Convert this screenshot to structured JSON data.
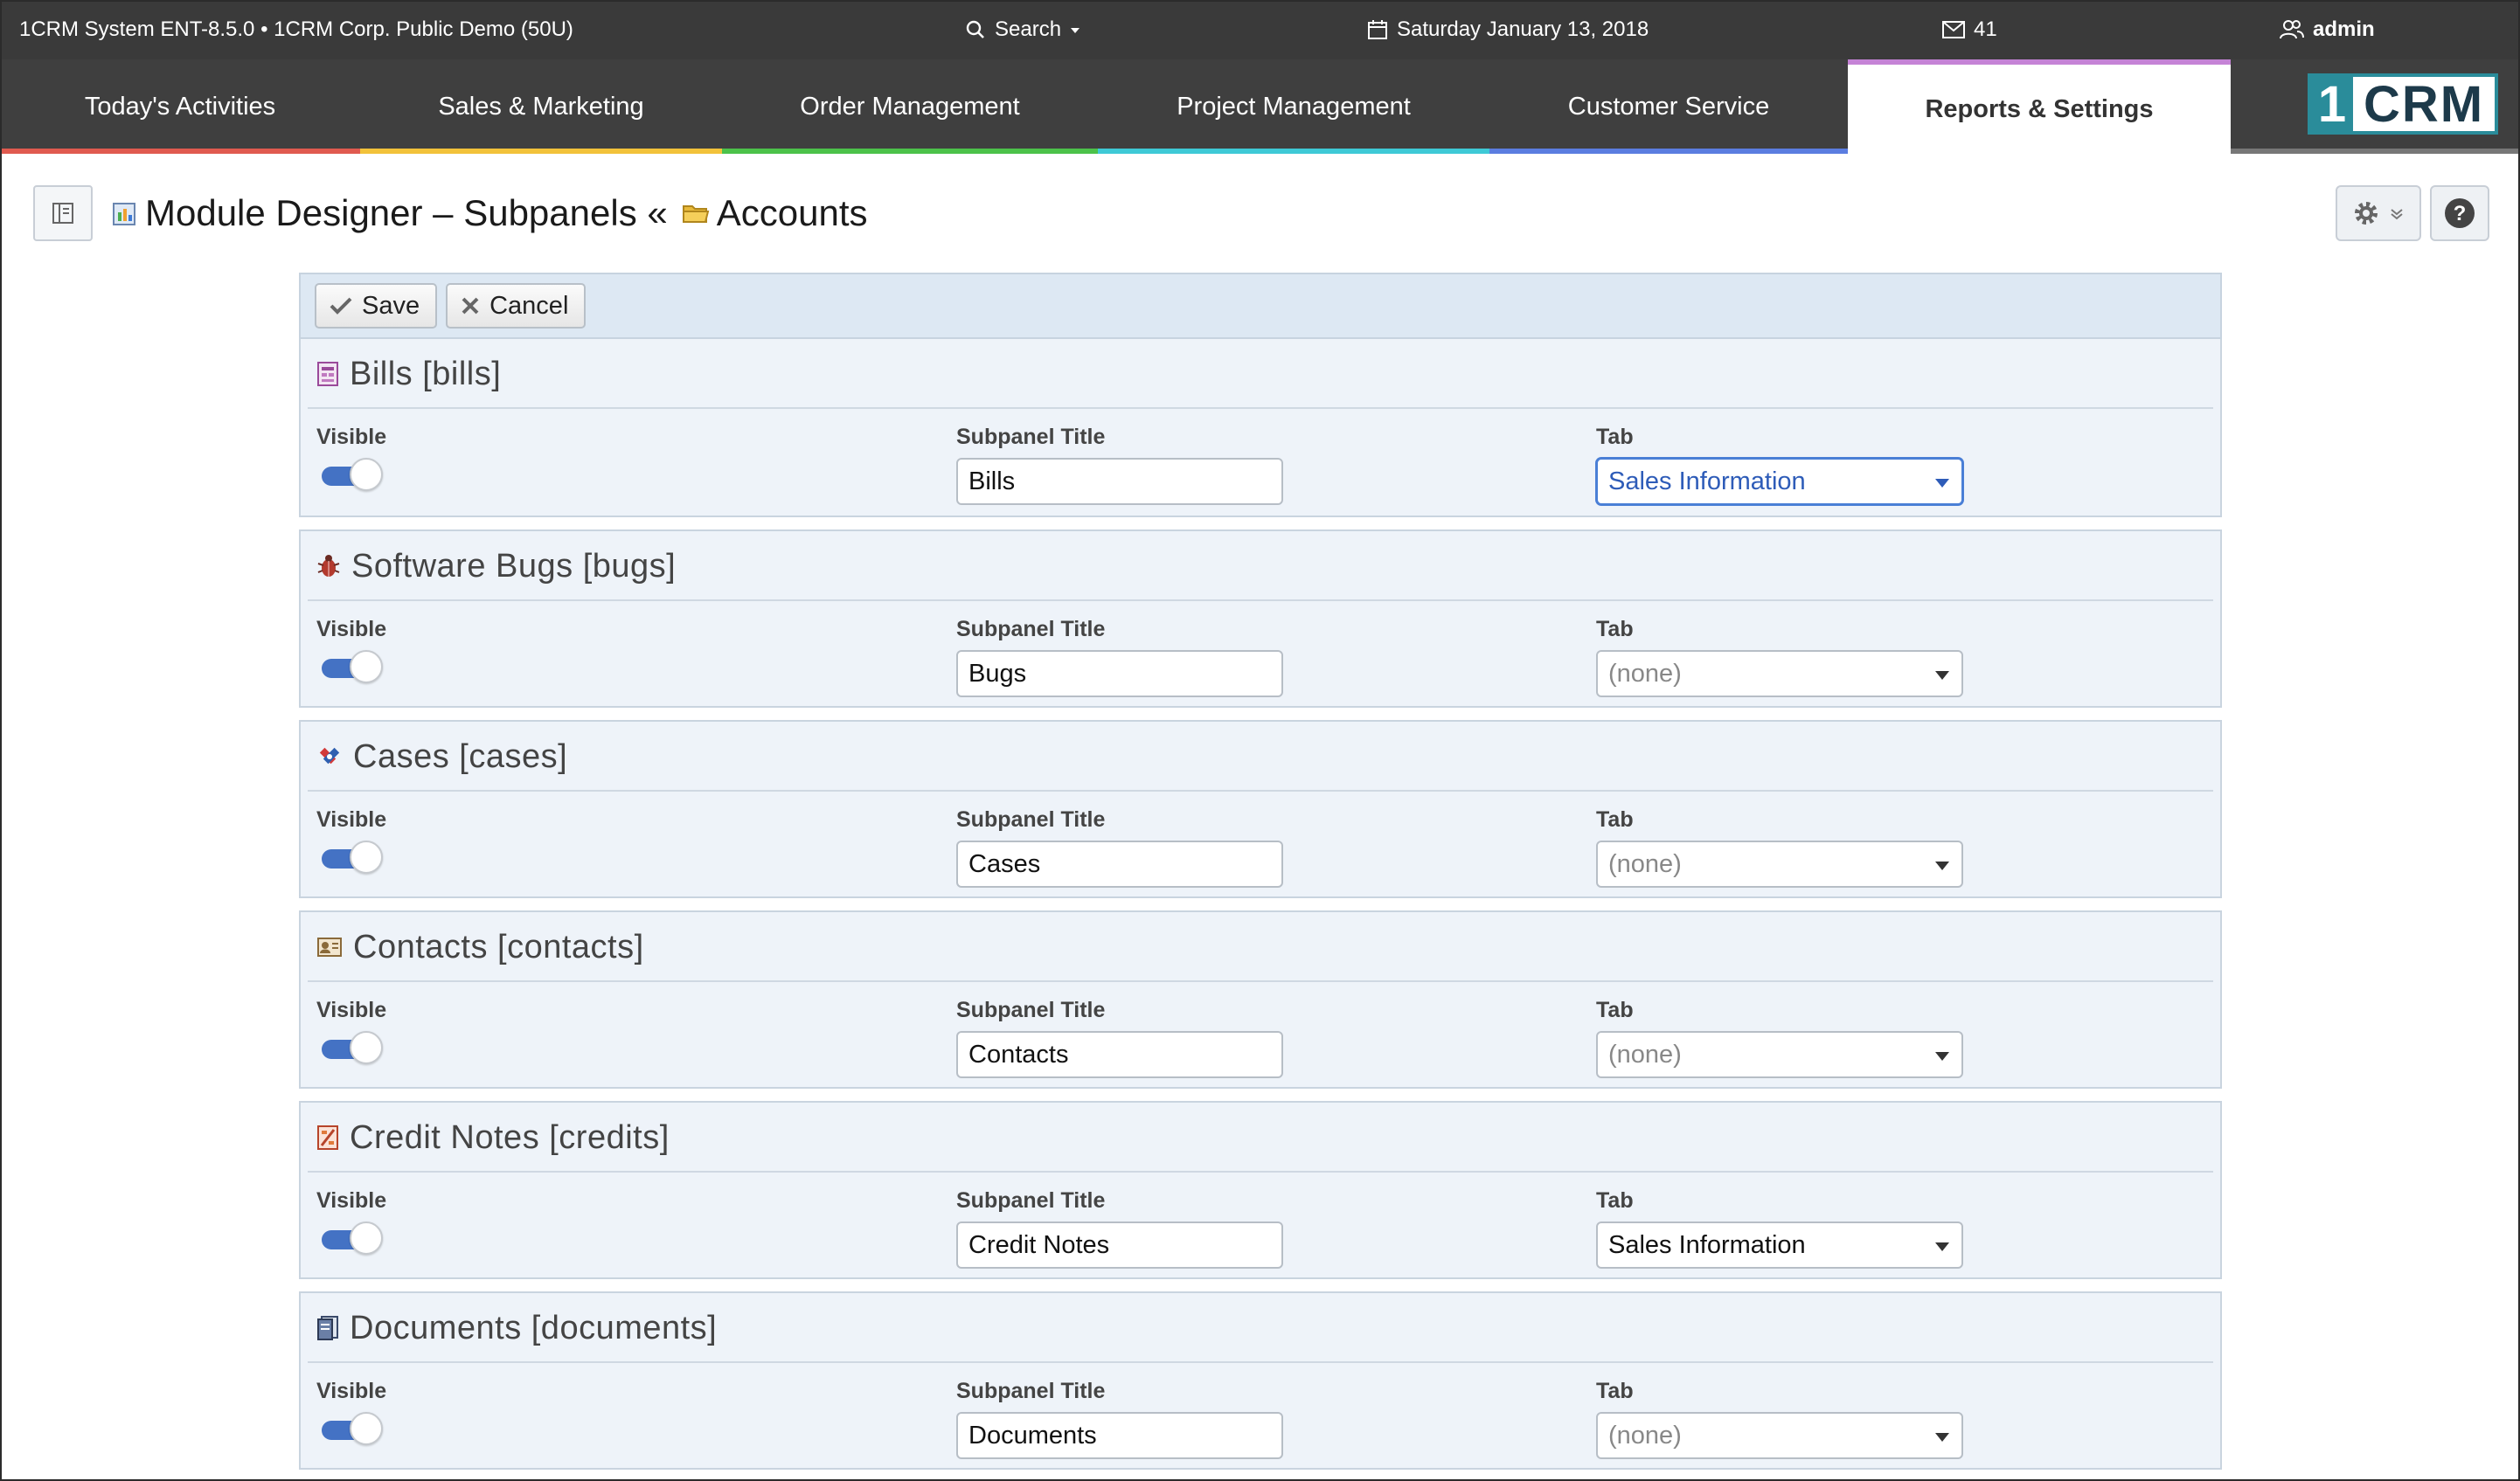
{
  "topbar": {
    "system": "1CRM System ENT-8.5.0 • 1CRM Corp. Public Demo (50U)",
    "search_label": "Search",
    "date": "Saturday January 13, 2018",
    "mail_count": "41",
    "user": "admin"
  },
  "nav": {
    "tabs": [
      {
        "label": "Today's Activities",
        "color": "#e05a4f"
      },
      {
        "label": "Sales & Marketing",
        "color": "#f2c23a"
      },
      {
        "label": "Order Management",
        "color": "#4cc24a"
      },
      {
        "label": "Project Management",
        "color": "#3ec9d6"
      },
      {
        "label": "Customer Service",
        "color": "#5b7de0"
      },
      {
        "label": "Reports & Settings",
        "color": "#c583d6",
        "active": true
      }
    ],
    "logo_one": "1",
    "logo_crm": "CRM"
  },
  "header": {
    "title": "Module Designer – Subpanels «",
    "module": "Accounts"
  },
  "toolbar": {
    "save_label": "Save",
    "cancel_label": "Cancel"
  },
  "labels": {
    "visible": "Visible",
    "subpanel_title": "Subpanel Title",
    "tab": "Tab"
  },
  "panels": [
    {
      "heading": "Bills [bills]",
      "icon": "bills-icon",
      "visible": true,
      "title": "Bills",
      "tab": "Sales Information"
    },
    {
      "heading": "Software Bugs [bugs]",
      "icon": "bug-icon",
      "visible": true,
      "title": "Bugs",
      "tab": "(none)"
    },
    {
      "heading": "Cases [cases]",
      "icon": "cases-icon",
      "visible": true,
      "title": "Cases",
      "tab": "(none)"
    },
    {
      "heading": "Contacts [contacts]",
      "icon": "contacts-icon",
      "visible": true,
      "title": "Contacts",
      "tab": "(none)"
    },
    {
      "heading": "Credit Notes [credits]",
      "icon": "credit-notes-icon",
      "visible": true,
      "title": "Credit Notes",
      "tab": "Sales Information"
    },
    {
      "heading": "Documents [documents]",
      "icon": "documents-icon",
      "visible": true,
      "title": "Documents",
      "tab": "(none)"
    }
  ]
}
